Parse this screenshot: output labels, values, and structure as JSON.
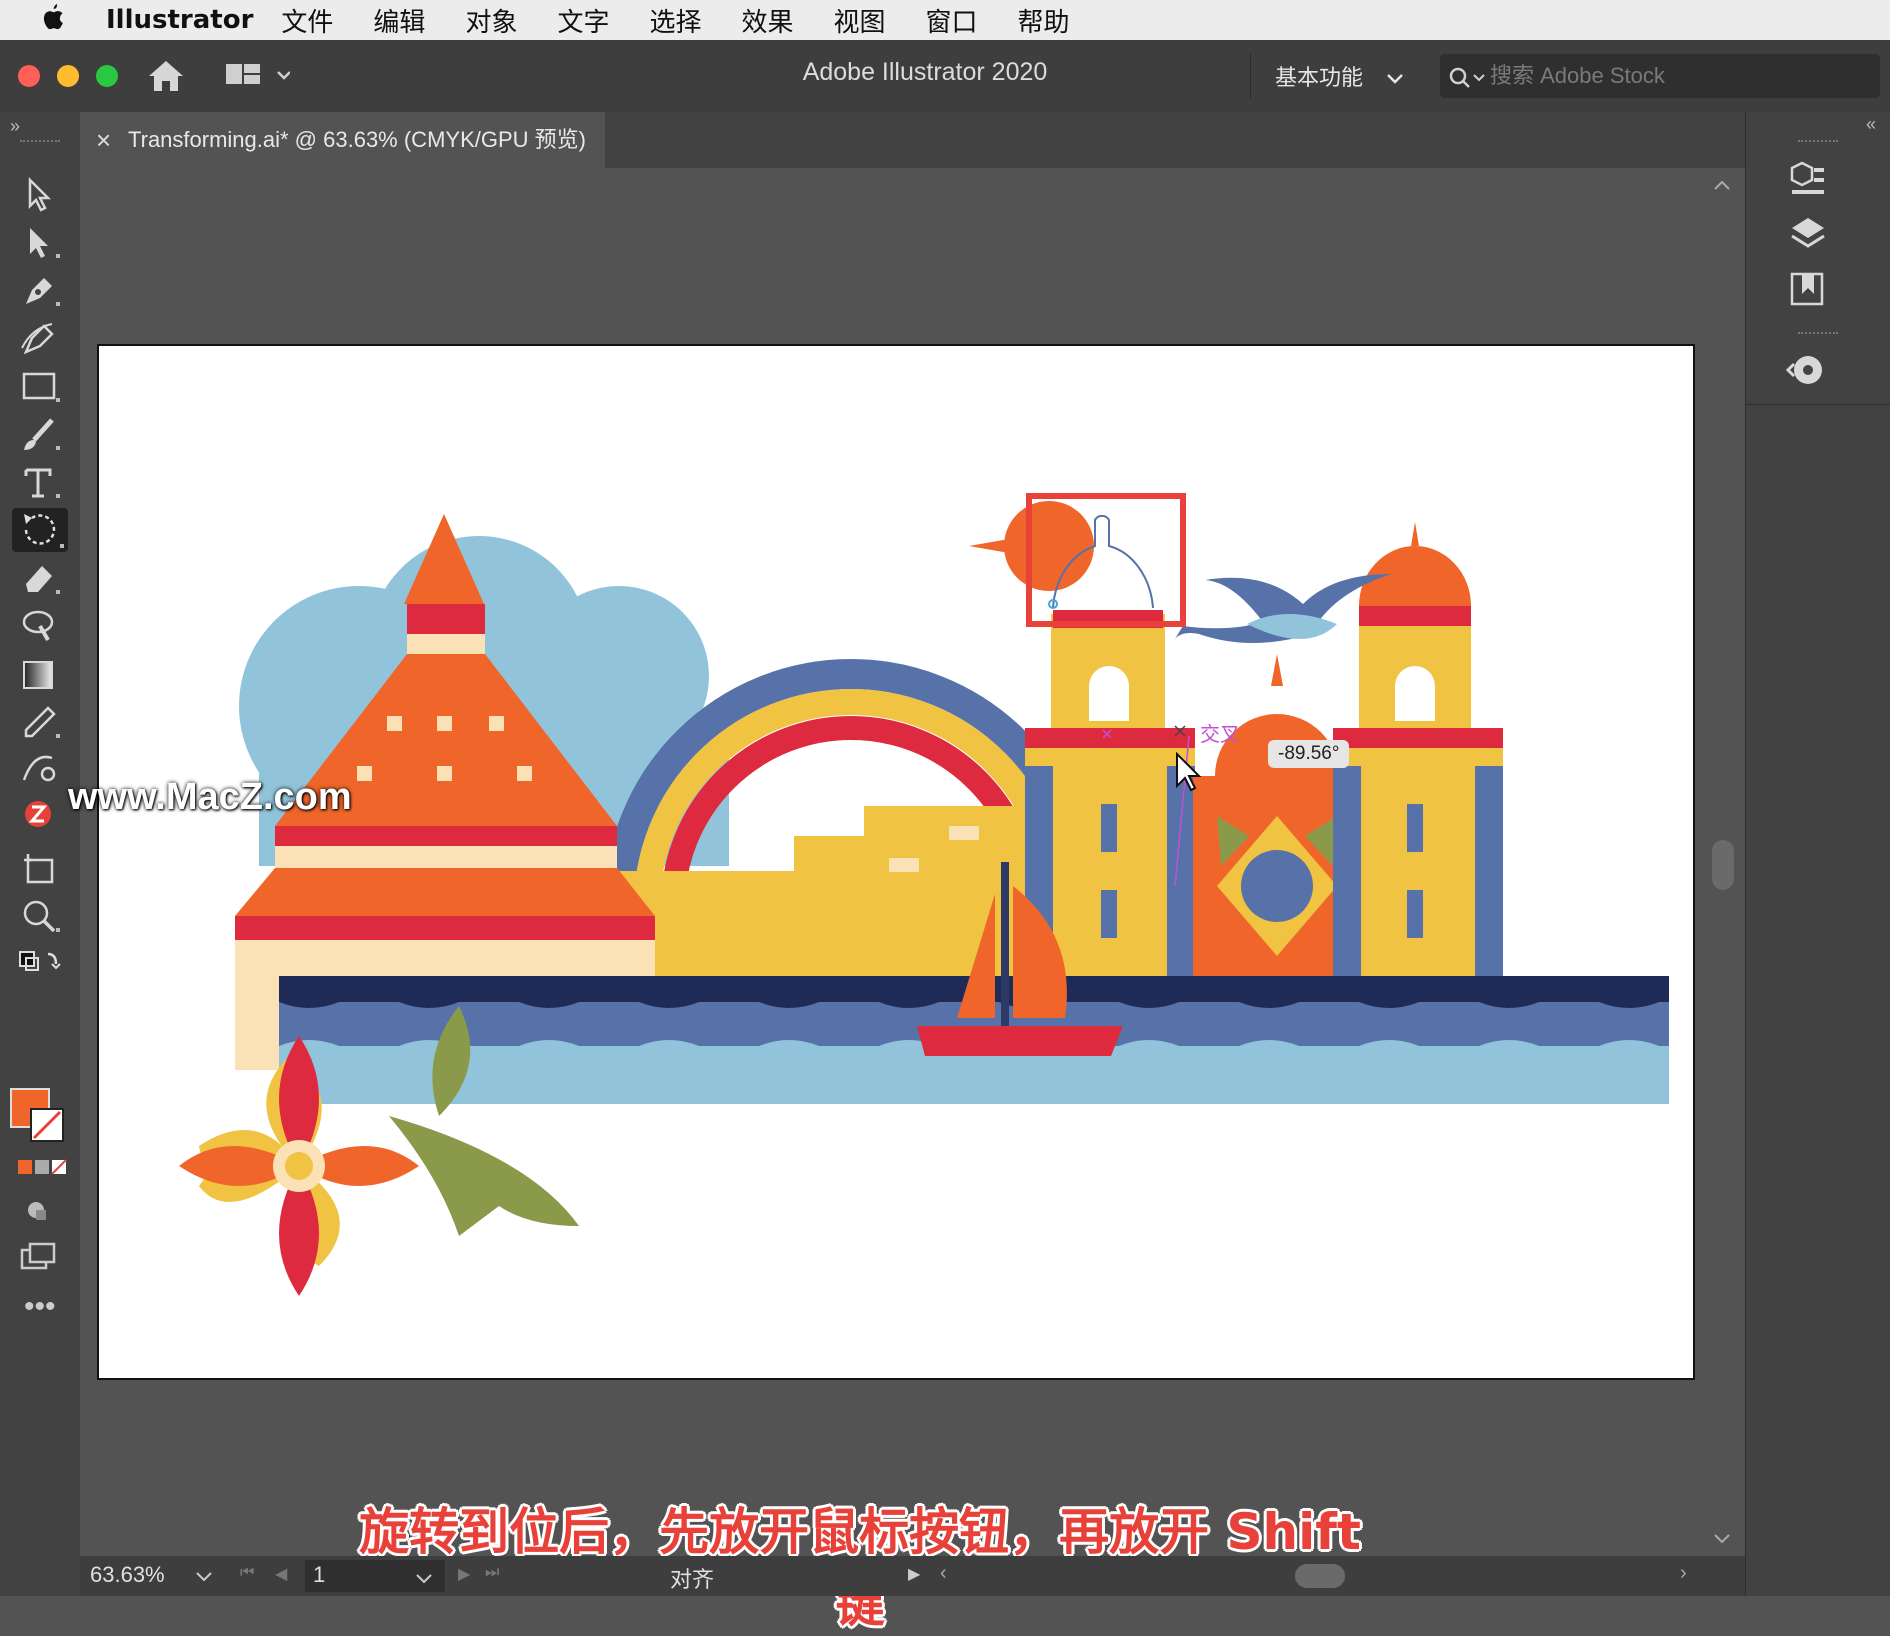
{
  "menubar": {
    "apple": "",
    "app_name": "Illustrator",
    "items": [
      "文件",
      "编辑",
      "对象",
      "文字",
      "选择",
      "效果",
      "视图",
      "窗口",
      "帮助"
    ]
  },
  "titlebar": {
    "title": "Adobe Illustrator 2020",
    "workspace": "基本功能",
    "search_placeholder": "搜索 Adobe Stock"
  },
  "document_tab": {
    "close": "×",
    "label": "Transforming.ai* @ 63.63% (CMYK/GPU 预览)"
  },
  "canvas": {
    "angle_tooltip": "-89.56°",
    "smart_guide_label": "交叉"
  },
  "statusbar": {
    "zoom": "63.63%",
    "page": "1",
    "status": "对齐"
  },
  "subtitle": "旋转到位后，先放开鼠标按钮，再放开 Shift 键",
  "watermark": "www.MacZ.com",
  "colors": {
    "fill": "#f0662a",
    "highlight_box": "#e8413a"
  }
}
